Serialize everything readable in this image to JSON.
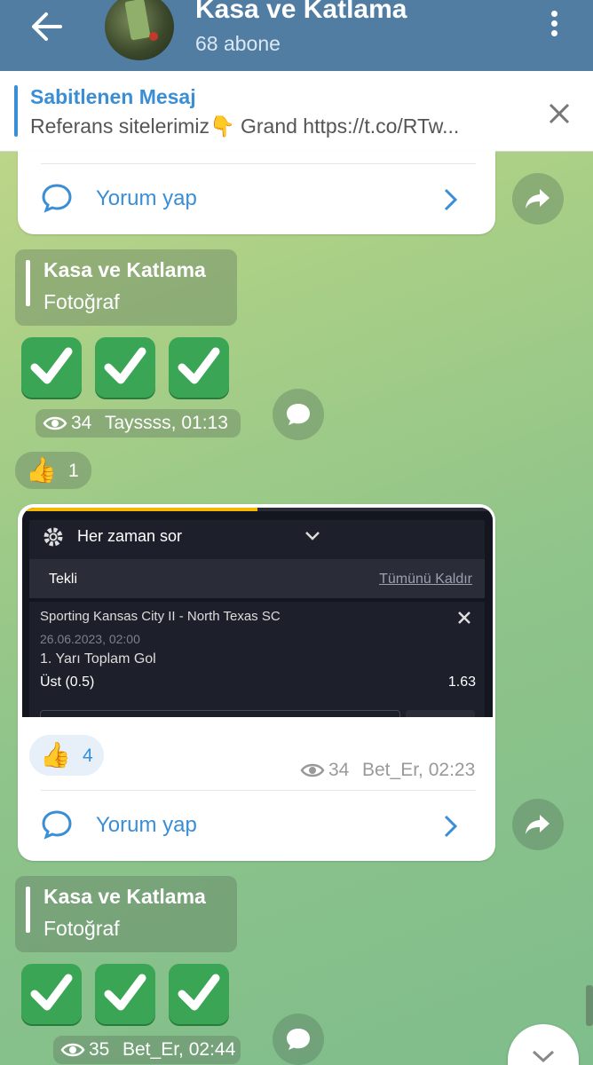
{
  "header": {
    "title": "Kasa ve Katlama",
    "subtitle": "68 abone"
  },
  "pinned": {
    "title": "Sabitlenen Mesaj",
    "text": "Referans sitelerimiz👇 Grand https://t.co/RTw..."
  },
  "comment_label": "Yorum yap",
  "messages": [
    {
      "forward_from": "Kasa ve Katlama",
      "forward_type": "Fotoğraf",
      "views": "34",
      "meta": "Tayssss, 01:13",
      "reaction_count": "1"
    },
    {
      "views": "35",
      "meta": "Bet_Er, 02:44",
      "forward_from": "Kasa ve Katlama",
      "forward_type": "Fotoğraf"
    }
  ],
  "post": {
    "views": "34",
    "meta": "Bet_Er, 02:23",
    "reaction_count": "4",
    "screenshot": {
      "ask": "Her zaman sor",
      "tab": "Tekli",
      "remove_all": "Tümünü Kaldır",
      "match": "Sporting Kansas City II - North Texas SC",
      "date": "26.06.2023, 02:00",
      "market": "1. Yarı Toplam Gol",
      "selection": "Üst (0.5)",
      "odds": "1.63"
    }
  },
  "colors": {
    "header": "#517da2",
    "accent": "#3a8ed6",
    "check": "#3aa655"
  }
}
